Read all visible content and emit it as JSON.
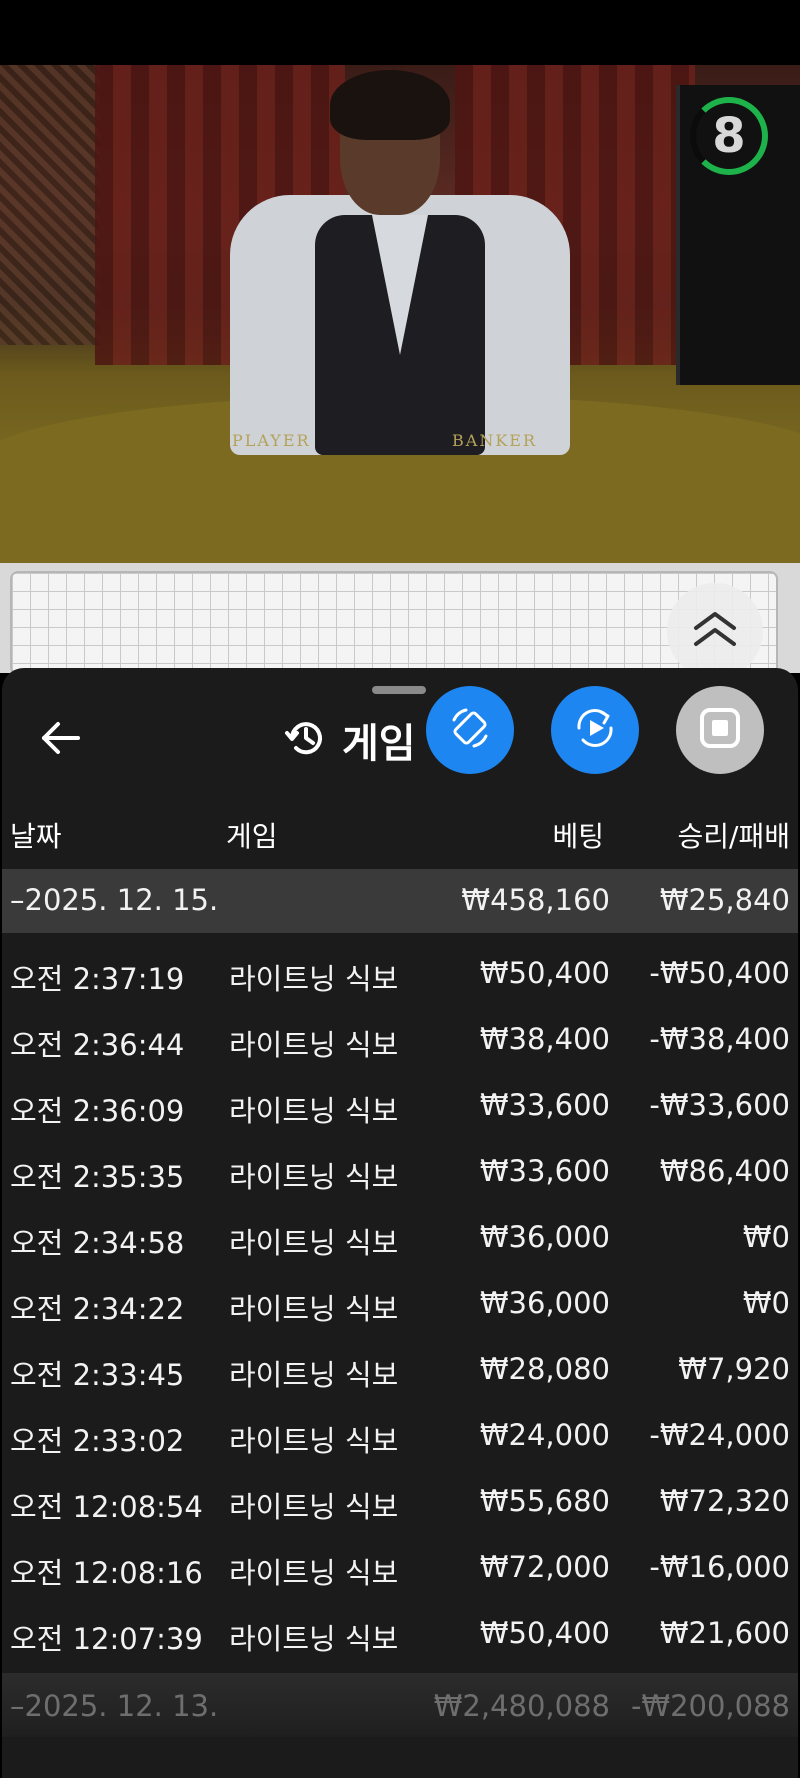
{
  "video": {
    "timer": "8",
    "table_labels": [
      "PLAYER",
      "BANKER"
    ]
  },
  "panel": {
    "title": "게임",
    "columns": {
      "date": "날짜",
      "game": "게임",
      "bet": "베팅",
      "result": "승리/패배"
    },
    "groups": [
      {
        "date": "–2025. 12. 15.",
        "bet_total": "₩458,160",
        "result_total": "₩25,840",
        "rows": [
          {
            "time": "오전 2:37:19",
            "game": "라이트닝 식보",
            "bet": "₩50,400",
            "result": "-₩50,400"
          },
          {
            "time": "오전 2:36:44",
            "game": "라이트닝 식보",
            "bet": "₩38,400",
            "result": "-₩38,400"
          },
          {
            "time": "오전 2:36:09",
            "game": "라이트닝 식보",
            "bet": "₩33,600",
            "result": "-₩33,600"
          },
          {
            "time": "오전 2:35:35",
            "game": "라이트닝 식보",
            "bet": "₩33,600",
            "result": "₩86,400"
          },
          {
            "time": "오전 2:34:58",
            "game": "라이트닝 식보",
            "bet": "₩36,000",
            "result": "₩0"
          },
          {
            "time": "오전 2:34:22",
            "game": "라이트닝 식보",
            "bet": "₩36,000",
            "result": "₩0"
          },
          {
            "time": "오전 2:33:45",
            "game": "라이트닝 식보",
            "bet": "₩28,080",
            "result": "₩7,920"
          },
          {
            "time": "오전 2:33:02",
            "game": "라이트닝 식보",
            "bet": "₩24,000",
            "result": "-₩24,000"
          },
          {
            "time": "오전 12:08:54",
            "game": "라이트닝 식보",
            "bet": "₩55,680",
            "result": "₩72,320"
          },
          {
            "time": "오전 12:08:16",
            "game": "라이트닝 식보",
            "bet": "₩72,000",
            "result": "-₩16,000"
          },
          {
            "time": "오전 12:07:39",
            "game": "라이트닝 식보",
            "bet": "₩50,400",
            "result": "₩21,600"
          }
        ]
      },
      {
        "date": "–2025. 12. 13.",
        "bet_total": "₩2,480,088",
        "result_total": "-₩200,088",
        "rows": []
      }
    ]
  },
  "icons": {
    "back": "arrow-left-icon",
    "history": "history-icon",
    "fab1": "rotate-screen-icon",
    "fab2": "replay-icon",
    "fab3": "stop-icon",
    "roadmap_toggle": "chevron-double-up-icon"
  },
  "colors": {
    "banker": "#d0343a",
    "player": "#2f74c8",
    "tie": "#2a8a3a",
    "fab_blue": "#1e86f0",
    "panel_bg": "#1b1b1b",
    "group_bg": "#3a3a3a"
  }
}
